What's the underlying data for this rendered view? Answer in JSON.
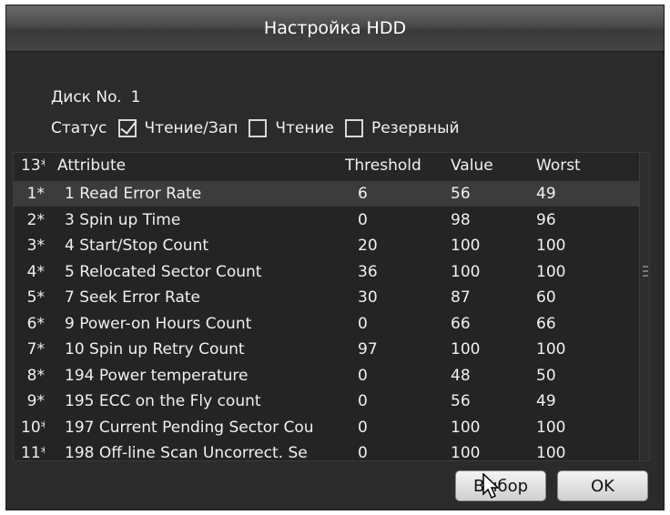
{
  "dialog": {
    "title": "Настройка HDD"
  },
  "disk": {
    "label": "Диск No.",
    "number": "1"
  },
  "status": {
    "label": "Статус",
    "options": [
      {
        "label": "Чтение/Зап",
        "checked": true
      },
      {
        "label": "Чтение",
        "checked": false
      },
      {
        "label": "Резервный",
        "checked": false
      }
    ]
  },
  "smart_table": {
    "headers": {
      "index": "13*",
      "attribute": "Attribute",
      "threshold": "Threshold",
      "value": "Value",
      "worst": "Worst"
    },
    "rows": [
      {
        "index": "1*",
        "attribute": "1 Read Error Rate",
        "threshold": "6",
        "value": "56",
        "worst": "49"
      },
      {
        "index": "2*",
        "attribute": "3 Spin up Time",
        "threshold": "0",
        "value": "98",
        "worst": "96"
      },
      {
        "index": "3*",
        "attribute": "4 Start/Stop Count",
        "threshold": "20",
        "value": "100",
        "worst": "100"
      },
      {
        "index": "4*",
        "attribute": "5 Relocated Sector Count",
        "threshold": "36",
        "value": "100",
        "worst": "100"
      },
      {
        "index": "5*",
        "attribute": "7 Seek Error Rate",
        "threshold": "30",
        "value": "87",
        "worst": "60"
      },
      {
        "index": "6*",
        "attribute": "9 Power-on Hours Count",
        "threshold": "0",
        "value": "66",
        "worst": "66"
      },
      {
        "index": "7*",
        "attribute": "10 Spin up Retry Count",
        "threshold": "97",
        "value": "100",
        "worst": "100"
      },
      {
        "index": "8*",
        "attribute": "194 Power temperature",
        "threshold": "0",
        "value": "48",
        "worst": "50"
      },
      {
        "index": "9*",
        "attribute": "195 ECC on the Fly count",
        "threshold": "0",
        "value": "56",
        "worst": "49"
      },
      {
        "index": "10*",
        "attribute": "197 Current Pending Sector Cou",
        "threshold": "0",
        "value": "100",
        "worst": "100"
      },
      {
        "index": "11*",
        "attribute": "198 Off-line Scan Uncorrect. Se",
        "threshold": "0",
        "value": "100",
        "worst": "100"
      }
    ]
  },
  "buttons": {
    "select": "Выбор",
    "ok": "OK"
  }
}
